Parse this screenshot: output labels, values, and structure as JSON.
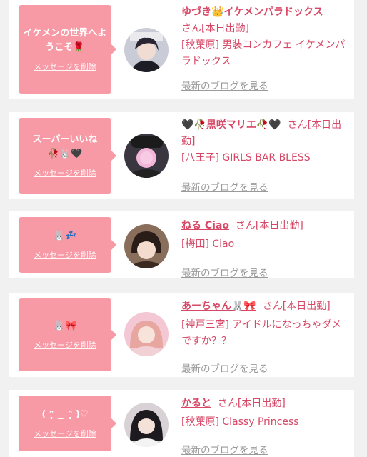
{
  "delete_label": "メッセージを削除",
  "blog_label": "最新のブログを見る",
  "colors": {
    "accent": "#d64866",
    "bubble": "#f89aa6",
    "background": "#f1f1f1"
  },
  "cards": [
    {
      "message": "イケメンの世界へようこそ🌹",
      "name": "ゆづき👑イケメンパラドックス",
      "suffix": "さん[本日出勤]",
      "shop": "[秋葉原] 男装コンカフェ イケメンパラドックス"
    },
    {
      "message": "スーパーいいね🥀🐰🖤",
      "name": "🖤🥀黒咲マリエ🥀🖤",
      "suffix": "さん[本日出勤]",
      "shop": "[八王子] GIRLS BAR BLESS"
    },
    {
      "message": "🐰💤",
      "name": "ねる Ciao",
      "suffix": "さん[本日出勤]",
      "shop": "[梅田] Ciao"
    },
    {
      "message": "🐰🎀",
      "name": "あーちゃん🐰🎀",
      "suffix": "さん[本日出勤]",
      "shop": "[神戸三宮] アイドルになっちゃダメですか？？"
    },
    {
      "message": "( ᵔ̥ ‿ ᵔ̥ )♡",
      "name": "かると",
      "suffix": "さん[本日出勤]",
      "shop": "[秋葉原] Classy Princess"
    }
  ]
}
